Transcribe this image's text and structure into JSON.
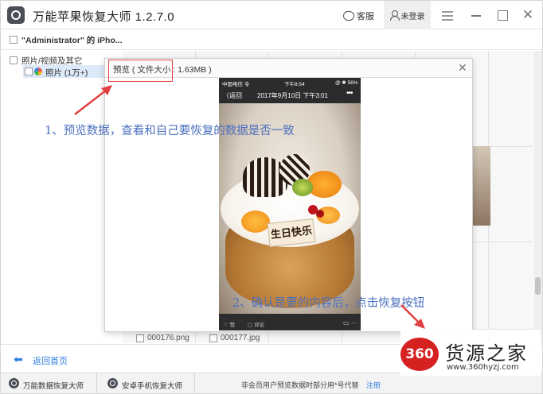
{
  "app": {
    "title": "万能苹果恢复大师 1.2.7.0"
  },
  "titlebar": {
    "feedback_label": "客服",
    "login_label": "未登录"
  },
  "device": {
    "name": "\"Administrator\" 的 iPho..."
  },
  "sidebar": {
    "category": "照片/视频及其它",
    "items": [
      {
        "label": "照片 (1万+)"
      }
    ]
  },
  "files": [
    {
      "name": "000176.png"
    },
    {
      "name": "000177.jpg"
    }
  ],
  "preview": {
    "title": "预览 ( 文件大小 : 1.63MB )",
    "phone": {
      "carrier": "中国电信 令",
      "time": "下午8:54",
      "battery": "@ ✱ 56%",
      "back": "〈返回",
      "datetime": "2017年9月10日 下午3:01",
      "plaque_text": "生日快乐",
      "bottom_left": "♡ 赞",
      "bottom_comment": "▢ 评论",
      "bottom_right": "▭ ⋯"
    }
  },
  "annotations": {
    "step1": "1、预览数据，查看和自己要恢复的数据是否一致",
    "step2": "2、确认是要的内容后，点击恢复按钮"
  },
  "back_home": {
    "label": "返回首页"
  },
  "bottombar": {
    "app1": "万能数据恢复大师",
    "app2": "安卓手机恢复大师",
    "notice": "非会员用户预览数据时部分用*号代替",
    "register": "注册"
  },
  "watermark": {
    "badge": "360",
    "title": "货源之家",
    "url": "www.360hyzj.com"
  },
  "colors": {
    "accent": "#2e7de0",
    "annotation": "#4a6fbe",
    "highlight_box": "#e04040",
    "watermark_red": "#d62121"
  }
}
